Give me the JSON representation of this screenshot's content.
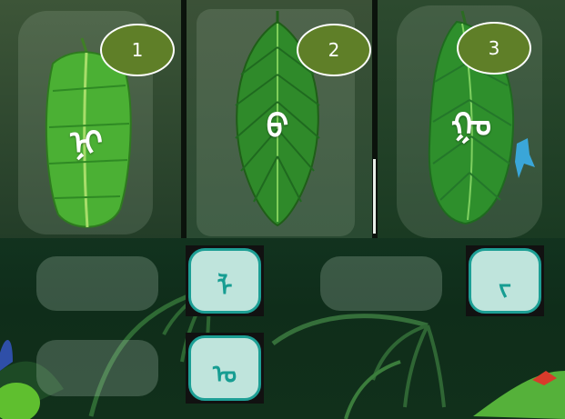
{
  "leaves": [
    {
      "number": "1",
      "letter": "ᠨᠢ"
    },
    {
      "number": "2",
      "letter": "ᠪ"
    },
    {
      "number": "3",
      "letter": "ᠭᠣ"
    }
  ],
  "tiles": [
    {
      "letter": "ᠯ"
    },
    {
      "letter": "ᠤ"
    },
    {
      "letter": "ᠵ"
    }
  ],
  "colors": {
    "badge": "#5f7f28",
    "tile_border": "#1d9f95",
    "tile_bg": "#bfe4dc",
    "leaf": "#3c9b2a"
  }
}
